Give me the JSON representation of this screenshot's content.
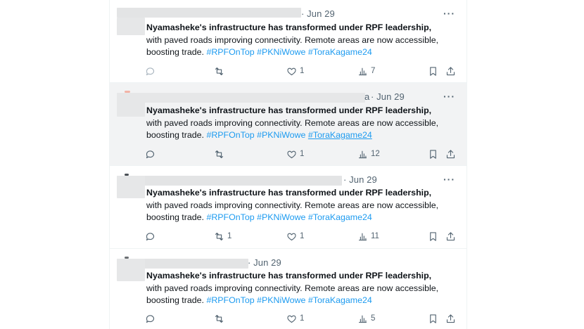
{
  "tweets": [
    {
      "date": "· Jun 29",
      "handle_suffix": "",
      "lead": "Nyamasheke's infrastructure has transformed under RPF leadership,",
      "line2": "with paved roads improving connectivity. Remote areas are now accessible,",
      "line3_text": "boosting trade.",
      "tags": [
        "#RPFOnTop",
        "#PKNiWowe",
        "#ToraKagame24"
      ],
      "reply_count": "",
      "retweet_count": "",
      "like_count": "1",
      "view_count": "7",
      "more": "···"
    },
    {
      "date": "· Jun 29",
      "handle_suffix": "a",
      "lead": "Nyamasheke's infrastructure has transformed under RPF leadership,",
      "line2": "with paved roads improving connectivity. Remote areas are now accessible,",
      "line3_text": "boosting trade.",
      "tags": [
        "#RPFOnTop",
        "#PKNiWowe",
        "#ToraKagame24"
      ],
      "reply_count": "",
      "retweet_count": "",
      "like_count": "1",
      "view_count": "12",
      "more": "···"
    },
    {
      "date": "· Jun 29",
      "handle_suffix": "",
      "lead": "Nyamasheke's infrastructure has transformed under RPF leadership,",
      "line2": "with paved roads improving connectivity. Remote areas are now accessible,",
      "line3_text": "boosting trade.",
      "tags": [
        "#RPFOnTop",
        "#PKNiWowe",
        "#ToraKagame24"
      ],
      "reply_count": "",
      "retweet_count": "1",
      "like_count": "1",
      "view_count": "11",
      "more": "···"
    },
    {
      "date": "· Jun 29",
      "handle_suffix": "",
      "lead": "Nyamasheke's infrastructure has transformed under RPF leadership,",
      "line2": "with paved roads improving connectivity. Remote areas are now accessible,",
      "line3_text": "boosting trade.",
      "tags": [
        "#RPFOnTop",
        "#PKNiWowe",
        "#ToraKagame24"
      ],
      "reply_count": "",
      "retweet_count": "",
      "like_count": "1",
      "view_count": "5",
      "more": ""
    }
  ],
  "icons": {
    "reply": "reply-icon",
    "retweet": "retweet-icon",
    "like": "heart-icon",
    "views": "views-icon",
    "bookmark": "bookmark-icon",
    "share": "share-icon"
  },
  "colors": {
    "hashtag": "#1d9bf0",
    "muted_text": "#536471",
    "highlight_bg": "#f2f3f4",
    "redaction": "#e3e4e5"
  }
}
